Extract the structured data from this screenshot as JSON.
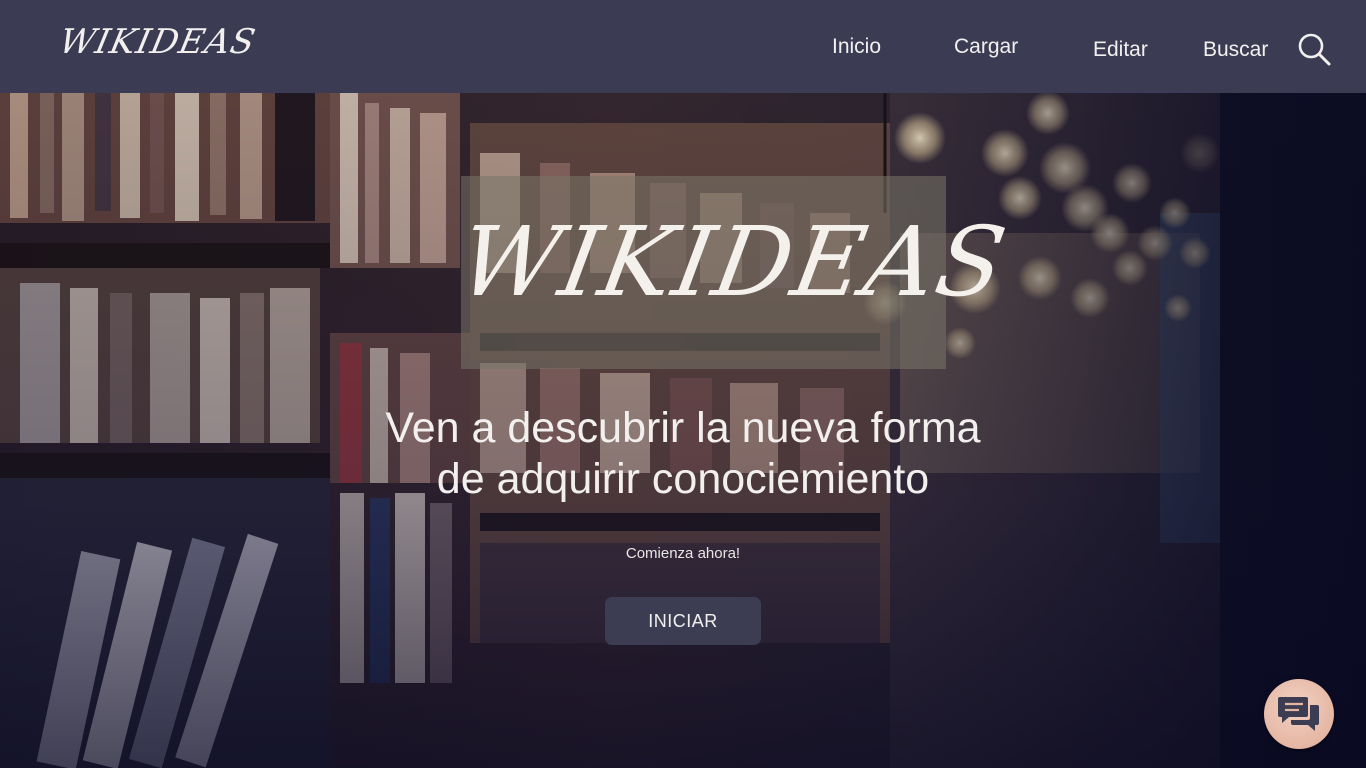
{
  "navbar": {
    "logo": "WIKIDEAS",
    "links": [
      {
        "label": "Inicio"
      },
      {
        "label": "Cargar"
      },
      {
        "label": "Editar"
      },
      {
        "label": "Buscar"
      }
    ],
    "search_icon": "search-icon"
  },
  "hero": {
    "logo": "WIKIDEAS",
    "headline_line1": "Ven a descubrir la nueva forma",
    "headline_line2": "de adquirir conociemiento",
    "subtitle": "Comienza ahora!",
    "button_label": "INICIAR",
    "background": "library-bookshelves-image"
  },
  "chat": {
    "icon": "chat-bubbles-icon"
  },
  "colors": {
    "navbar_bg": "#3b3c54",
    "button_bg": "#3c3d52",
    "text_light": "#f2f0ee",
    "chat_fab": "#e5b6a4"
  }
}
